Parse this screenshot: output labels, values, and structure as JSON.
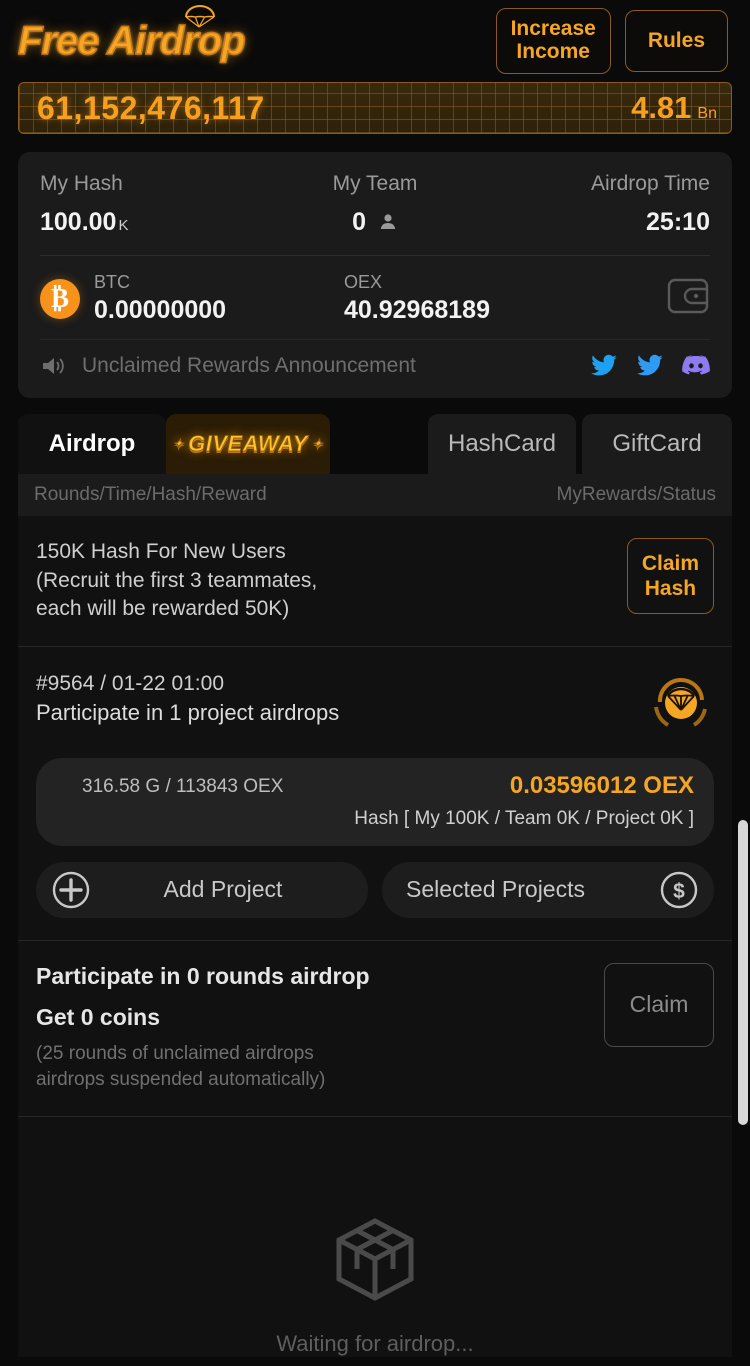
{
  "header": {
    "logo_text": "Free Airdrop",
    "logo_icon": "parachute-icon",
    "increase_income_label": "Increase\nIncome",
    "increase_income_line1": "Increase",
    "increase_income_line2": "Income",
    "rules_label": "Rules"
  },
  "hash_banner": {
    "total_hash": "61,152,476,117",
    "amount": "4.81",
    "unit": "Bn"
  },
  "stats": {
    "my_hash_label": "My Hash",
    "my_hash_value": "100.00",
    "my_hash_unit": "K",
    "my_team_label": "My Team",
    "my_team_value": "0",
    "airdrop_time_label": "Airdrop Time",
    "airdrop_time_value": "25:10"
  },
  "balances": {
    "btc_name": "BTC",
    "btc_value": "0.00000000",
    "oex_name": "OEX",
    "oex_value": "40.92968189",
    "wallet_icon": "wallet-icon"
  },
  "announcement": {
    "speaker_icon": "speaker-icon",
    "text": "Unclaimed Rewards Announcement",
    "socials": [
      "twitter-icon",
      "twitter-icon",
      "discord-icon"
    ],
    "colors": {
      "twitter1": "#1DA1F2",
      "twitter2": "#2E9BF5",
      "discord": "#8E7BF0"
    }
  },
  "tabs": [
    {
      "label": "Airdrop",
      "active": true
    },
    {
      "label": "GIVEAWAY",
      "active": false,
      "style": "badge"
    },
    {
      "label": "HashCard",
      "active": false
    },
    {
      "label": "GiftCard",
      "active": false
    }
  ],
  "subbar": {
    "left": "Rounds/Time/Hash/Reward",
    "right": "MyRewards/Status"
  },
  "promo": {
    "line1": "150K Hash For New Users",
    "line2": "(Recruit the first 3 teammates,",
    "line3": "each will be rewarded 50K)",
    "button_line1": "Claim",
    "button_line2": "Hash"
  },
  "round": {
    "id_time": "#9564 / 01-22 01:00",
    "description": "Participate in 1 project airdrops",
    "icon": "airdrop-parachute-icon",
    "hash_left": "316.58 G / 113843 OEX",
    "reward_amount": "0.03596012 OEX",
    "hash_breakdown": "Hash [ My 100K / Team 0K / Project 0K ]",
    "add_project_label": "Add Project",
    "add_project_icon": "plus-circle-icon",
    "selected_projects_label": "Selected Projects",
    "selected_projects_icon": "dollar-circle-icon"
  },
  "participation": {
    "line1": "Participate in 0 rounds airdrop",
    "line2": "Get 0 coins",
    "note_line1": "(25 rounds of unclaimed airdrops",
    "note_line2": "airdrops suspended automatically)",
    "claim_label": "Claim"
  },
  "empty_state": {
    "icon": "package-box-icon",
    "label": "Waiting for airdrop..."
  },
  "theme": {
    "accent": "#F5A623",
    "accent_bright": "#F7A01E",
    "background": "#0a0a0a",
    "card": "#1b1b1b",
    "btc_orange": "#F7931A"
  }
}
